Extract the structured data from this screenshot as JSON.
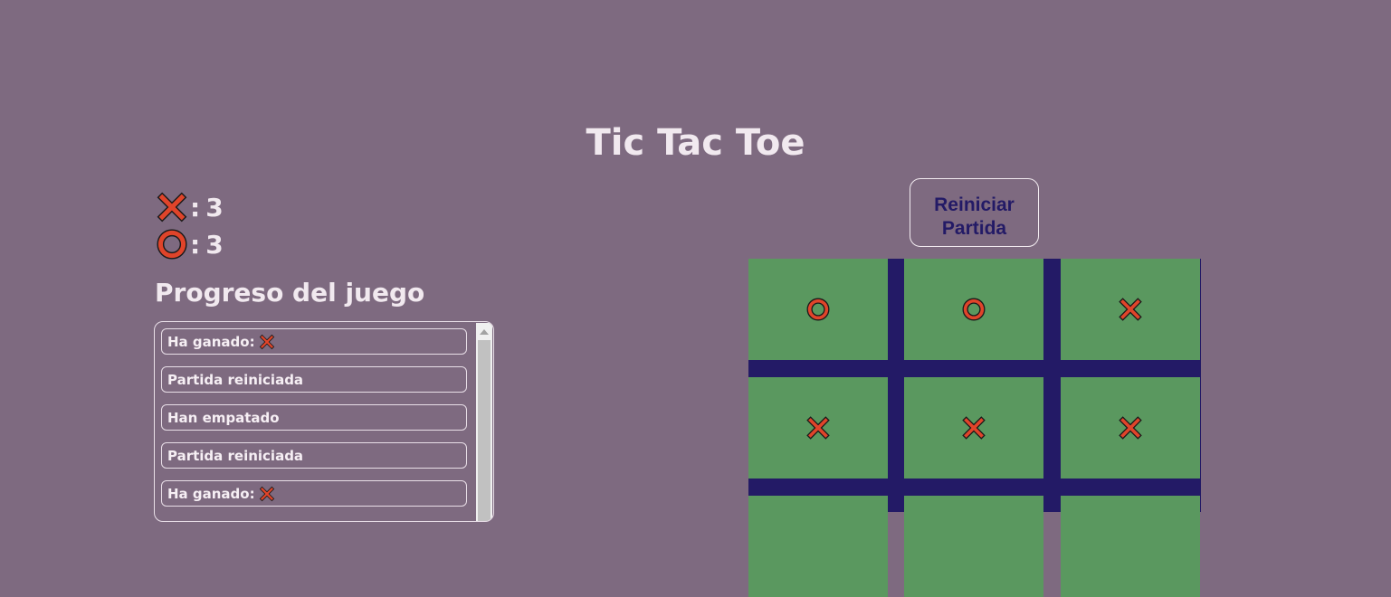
{
  "title": "Tic Tac Toe",
  "scores": {
    "x": {
      "icon": "x-mark-icon",
      "separator": ":",
      "value": "3"
    },
    "o": {
      "icon": "o-mark-icon",
      "separator": ":",
      "value": "3"
    }
  },
  "progress": {
    "heading": "Progreso del juego",
    "log": [
      {
        "text": "Ha ganado:",
        "icon": "x-mark-icon"
      },
      {
        "text": "Partida reiniciada",
        "icon": null
      },
      {
        "text": "Han empatado",
        "icon": null
      },
      {
        "text": "Partida reiniciada",
        "icon": null
      },
      {
        "text": "Ha ganado:",
        "icon": "x-mark-icon"
      }
    ]
  },
  "reset_button": {
    "line1": "Reiniciar",
    "line2": "Partida"
  },
  "board": {
    "rows": [
      [
        "O",
        "O",
        "X"
      ],
      [
        "X",
        "X",
        "X"
      ],
      [
        "",
        "",
        ""
      ]
    ]
  },
  "colors": {
    "background": "#7e6a80",
    "board_lines": "#231a66",
    "cell": "#5a985f",
    "mark_fill": "#e0442a",
    "mark_stroke": "#1a1a1a",
    "text": "#f1e9ef",
    "button_text": "#231a66"
  }
}
